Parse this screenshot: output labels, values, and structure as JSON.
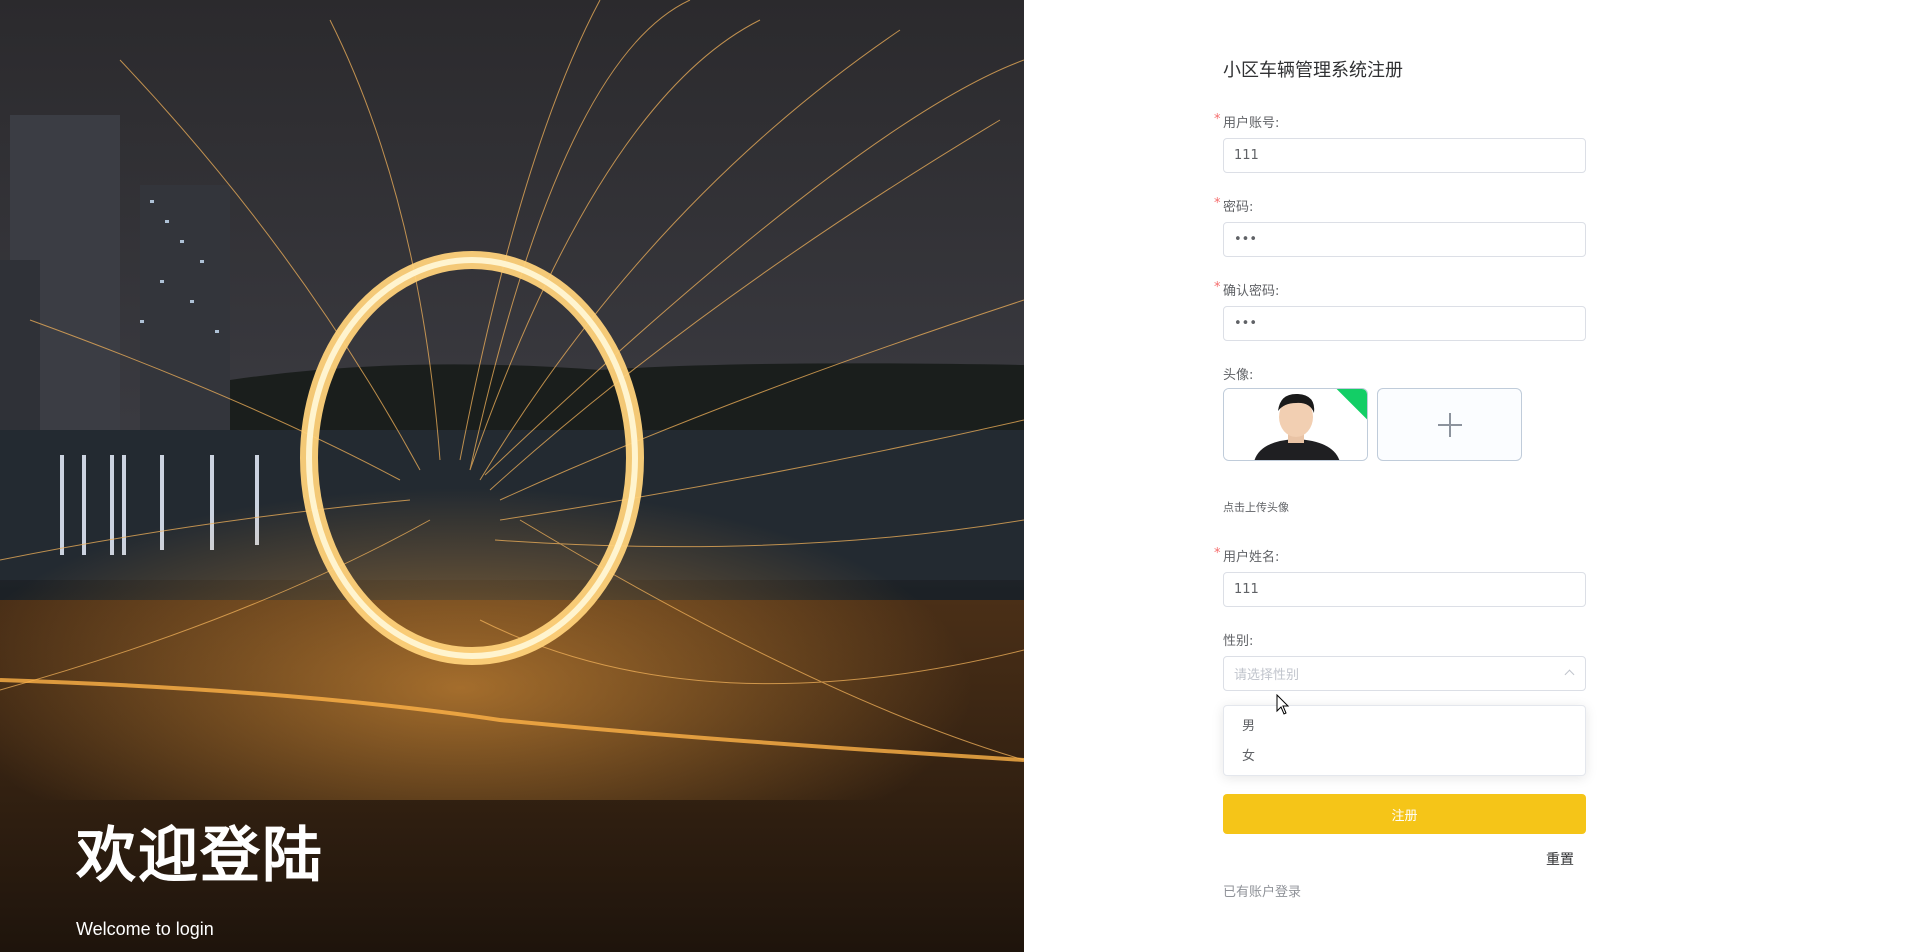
{
  "hero": {
    "title": "欢迎登陆",
    "subtitle": "Welcome to login"
  },
  "form": {
    "title": "小区车辆管理系统注册",
    "required_mark": "*",
    "account": {
      "label": "用户账号:",
      "value": "111"
    },
    "password": {
      "label": "密码:",
      "value": "•••"
    },
    "confirm_password": {
      "label": "确认密码:",
      "value": "•••"
    },
    "avatar": {
      "label": "头像:",
      "tip": "点击上传头像"
    },
    "name": {
      "label": "用户姓名:",
      "value": "111"
    },
    "gender": {
      "label": "性别:",
      "placeholder": "请选择性别",
      "options": [
        "男",
        "女"
      ]
    },
    "submit_label": "注册",
    "reset_label": "重置",
    "login_link": "已有账户登录"
  },
  "colors": {
    "accent": "#f5c518",
    "required": "#f56c6c",
    "upload_success": "#13ce66"
  },
  "icons": [
    "plus-icon",
    "chevron-up-icon",
    "mouse-cursor-icon",
    "check-corner-icon"
  ]
}
